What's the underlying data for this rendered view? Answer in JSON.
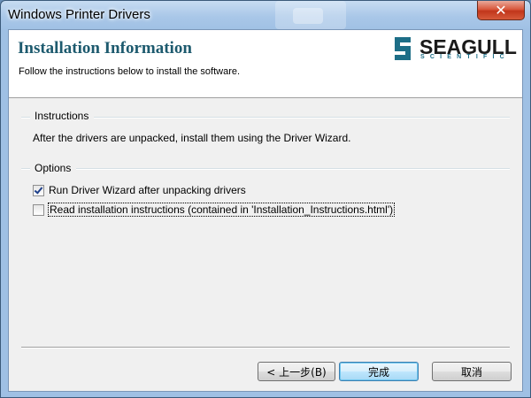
{
  "window": {
    "title": "Windows Printer Drivers",
    "close_label": "✕"
  },
  "header": {
    "title": "Installation Information",
    "subtitle": "Follow the instructions below to install the software.",
    "logo_word": "SEAGULL",
    "logo_sub": "SCIENTIFIC",
    "logo_color": "#1d6e87"
  },
  "instructions": {
    "group_label": "Instructions",
    "text": "After the drivers are unpacked, install them using the Driver Wizard."
  },
  "options": {
    "group_label": "Options",
    "items": [
      {
        "label": "Run Driver Wizard after unpacking drivers",
        "checked": true
      },
      {
        "label": "Read installation instructions (contained in 'Installation_Instructions.html')",
        "checked": false
      }
    ]
  },
  "buttons": {
    "back": "< 上一步(B)",
    "finish": "完成",
    "cancel": "取消"
  }
}
